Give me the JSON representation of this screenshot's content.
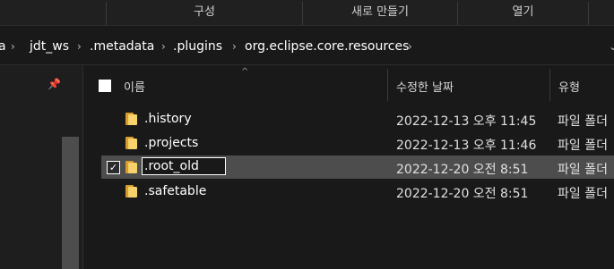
{
  "ribbon": {
    "groups": [
      "구성",
      "새로 만들기",
      "열기"
    ]
  },
  "address": {
    "breadcrumbs": [
      "a",
      "jdt_ws",
      ".metadata",
      ".plugins",
      "org.eclipse.core.resources"
    ],
    "separator_icon": "chevron-right-icon",
    "dropdown_icon": "chevron-down-icon"
  },
  "nav": {
    "pin_icon": "pin-icon"
  },
  "columns": {
    "name": "이름",
    "date": "수정한 날짜",
    "type": "유형",
    "sort_indicator": "^"
  },
  "files": [
    {
      "name": ".history",
      "date": "2022-12-13 오후 11:45",
      "type": "파일 폴더",
      "selected": false
    },
    {
      "name": ".projects",
      "date": "2022-12-13 오후 11:46",
      "type": "파일 폴더",
      "selected": false
    },
    {
      "name": ".root_old",
      "date": "2022-12-20 오전 8:51",
      "type": "파일 폴더",
      "selected": true,
      "renaming": true
    },
    {
      "name": ".safetable",
      "date": "2022-12-20 오전 8:51",
      "type": "파일 폴더",
      "selected": false
    }
  ],
  "colors": {
    "background": "#191919",
    "selection": "#4d4d4d",
    "folder": "#f7d16a"
  }
}
